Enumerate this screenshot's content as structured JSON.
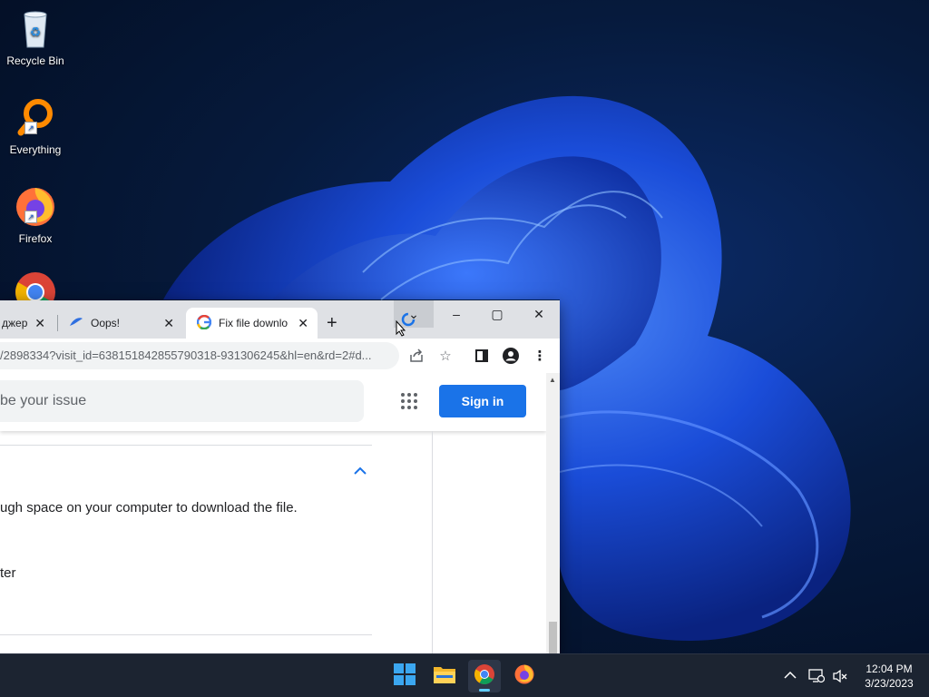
{
  "desktop": {
    "icons": [
      {
        "label": "Recycle Bin",
        "icon": "recycle-bin-icon"
      },
      {
        "label": "Everything",
        "icon": "everything-search-icon"
      },
      {
        "label": "Firefox",
        "icon": "firefox-icon"
      },
      {
        "label": "",
        "icon": "chrome-icon"
      }
    ]
  },
  "browser": {
    "tabs": [
      {
        "label": "джер",
        "active": false
      },
      {
        "label": "Oops!",
        "active": false,
        "icon": "oops-site-icon"
      },
      {
        "label": "Fix file downlo",
        "active": true,
        "icon": "google-g-icon"
      }
    ],
    "new_tab_symbol": "+",
    "window_controls": {
      "minimize": "–",
      "maximize": "▢",
      "close": "✕",
      "tab_search": "⌄"
    },
    "url": "/2898334?visit_id=638151842855790318-931306245&hl=en&rd=2#d...",
    "page": {
      "search_placeholder": "be your issue",
      "signin_label": "Sign in",
      "lines": [
        "ugh space on your computer to download the file.",
        "ter"
      ]
    }
  },
  "taskbar": {
    "apps": [
      {
        "name": "start",
        "icon": "windows-start-icon"
      },
      {
        "name": "file-explorer",
        "icon": "folder-icon"
      },
      {
        "name": "chrome",
        "icon": "chrome-icon",
        "active": true
      },
      {
        "name": "firefox",
        "icon": "firefox-icon"
      }
    ],
    "time": "12:04 PM",
    "date": "3/23/2023"
  },
  "colors": {
    "accent": "#1a73e8",
    "taskbar": "#1c2431",
    "wallpaper_bloom": "#1a4fe0"
  }
}
